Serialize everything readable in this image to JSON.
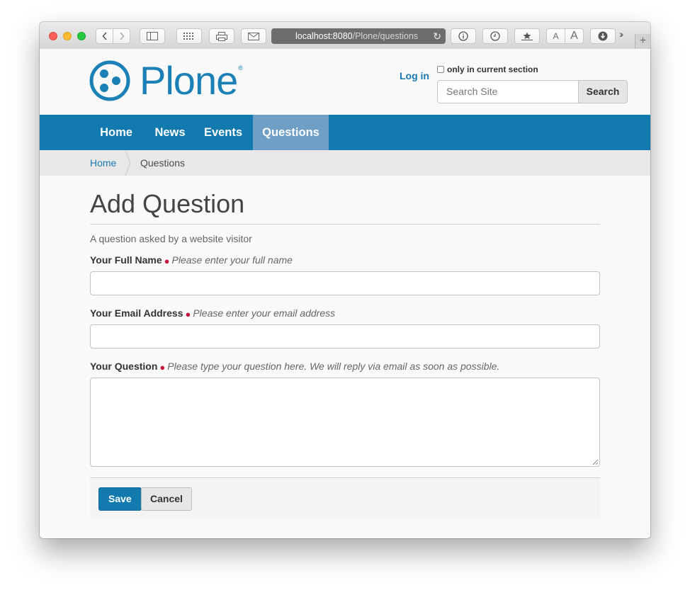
{
  "browser": {
    "url_host": "localhost:8080",
    "url_path": "/Plone/questions",
    "new_tab_symbol": "+"
  },
  "header": {
    "logo_text": "Plone",
    "logo_reg": "®",
    "login_label": "Log in",
    "section_checkbox_label": "only in current section",
    "search_placeholder": "Search Site",
    "search_button": "Search"
  },
  "nav": {
    "items": [
      {
        "label": "Home",
        "active": false
      },
      {
        "label": "News",
        "active": false
      },
      {
        "label": "Events",
        "active": false
      },
      {
        "label": "Questions",
        "active": true
      }
    ]
  },
  "breadcrumbs": {
    "home": "Home",
    "current": "Questions"
  },
  "form": {
    "title": "Add Question",
    "description": "A question asked by a website visitor",
    "fields": [
      {
        "label": "Your Full Name",
        "help": "Please enter your full name",
        "value": ""
      },
      {
        "label": "Your Email Address",
        "help": "Please enter your email address",
        "value": ""
      },
      {
        "label": "Your Question",
        "help": "Please type your question here. We will reply via email as soon as possible.",
        "value": ""
      }
    ],
    "required_marker": "●",
    "save_label": "Save",
    "cancel_label": "Cancel"
  },
  "colors": {
    "brand": "#1a80b6",
    "nav_bg": "#137aaf",
    "nav_active": "#6f9fc6",
    "required": "#c4183c"
  }
}
